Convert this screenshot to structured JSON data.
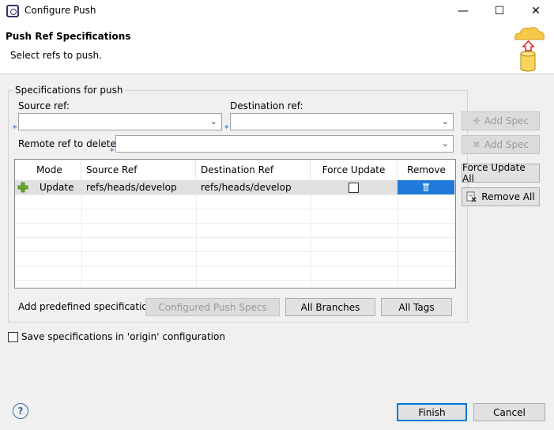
{
  "window": {
    "title": "Configure Push",
    "min": "—",
    "max": "☐",
    "close": "✕"
  },
  "header": {
    "title": "Push Ref Specifications",
    "subtitle": "Select refs to push."
  },
  "group": {
    "title": "Specifications for push",
    "source_label": "Source ref:",
    "source_value": "",
    "dest_label": "Destination ref:",
    "dest_value": "",
    "remote_delete_label": "Remote ref to delete:",
    "remote_delete_value": "",
    "required_marker": "*",
    "add_spec_label": "Add Spec",
    "add_spec_delete_label": "Add Spec"
  },
  "table": {
    "headers": [
      "Mode",
      "Source Ref",
      "Destination Ref",
      "Force Update",
      "Remove"
    ],
    "rows": [
      {
        "mode": "Update",
        "source": "refs/heads/develop",
        "destination": "refs/heads/develop",
        "force_update": false
      }
    ]
  },
  "side_buttons": {
    "force_update_all": "Force Update All",
    "remove_all": "Remove All"
  },
  "predefined": {
    "label": "Add predefined specification",
    "configured": "Configured Push Specs",
    "all_branches": "All Branches",
    "all_tags": "All Tags"
  },
  "save_spec": {
    "label": "Save specifications in 'origin' configuration",
    "checked": false
  },
  "footer": {
    "help": "?",
    "finish": "Finish",
    "cancel": "Cancel"
  },
  "icons": {
    "dropdown": "chevron-down-icon",
    "add": "plus-icon",
    "delete": "x-icon",
    "trash": "trash-icon",
    "help": "help-icon"
  },
  "colors": {
    "selection": "#1f7adb",
    "row_highlight": "#e0e0e0",
    "required": "#2a5caa"
  }
}
